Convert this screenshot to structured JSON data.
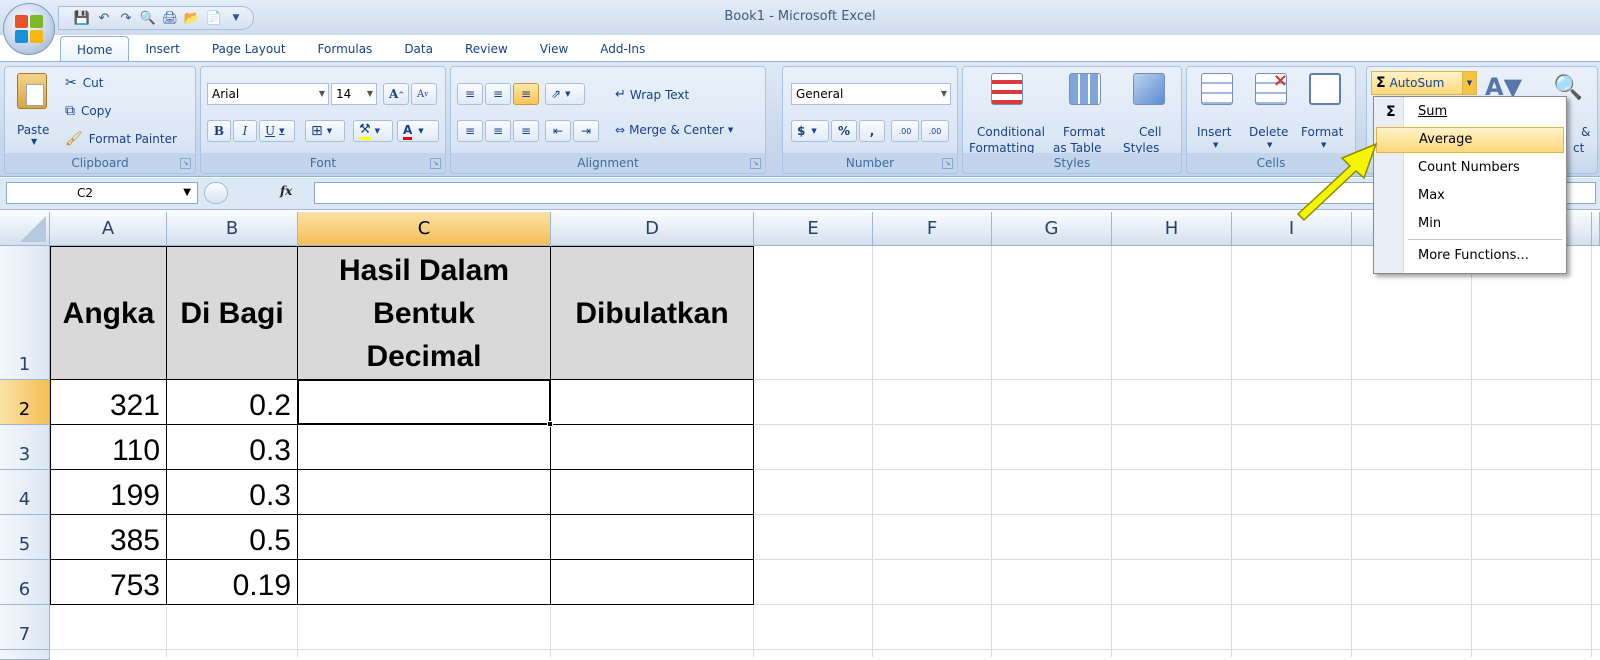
{
  "window": {
    "title": "Book1 - Microsoft Excel"
  },
  "tabs": [
    "Home",
    "Insert",
    "Page Layout",
    "Formulas",
    "Data",
    "Review",
    "View",
    "Add-Ins"
  ],
  "ribbon": {
    "clipboard": {
      "label": "Clipboard",
      "paste": "Paste",
      "cut": "Cut",
      "copy": "Copy",
      "format_painter": "Format Painter"
    },
    "font": {
      "label": "Font",
      "name": "Arial",
      "size": "14",
      "bold": "B",
      "italic": "I",
      "underline": "U",
      "grow": "A",
      "shrink": "A",
      "color_letter": "A"
    },
    "alignment": {
      "label": "Alignment",
      "wrap": "Wrap Text",
      "merge": "Merge & Center"
    },
    "number": {
      "label": "Number",
      "format": "General",
      "currency": "$",
      "percent": "%",
      "comma": ",",
      "inc_dec": ".00",
      "dec_dec": ".00"
    },
    "styles": {
      "label": "Styles",
      "conditional_1": "Conditional",
      "conditional_2": "Formatting",
      "format_table_1": "Format",
      "format_table_2": "as Table",
      "cell_styles_1": "Cell",
      "cell_styles_2": "Styles"
    },
    "cells": {
      "label": "Cells",
      "insert": "Insert",
      "delete": "Delete",
      "format": "Format"
    },
    "editing": {
      "autosum": "AutoSum",
      "sort_tail": "&",
      "sort_tail2": "ct"
    }
  },
  "formula_bar": {
    "name_box": "C2",
    "fx": "fx",
    "value": ""
  },
  "columns": [
    "A",
    "B",
    "C",
    "D",
    "E",
    "F",
    "G",
    "H",
    "I"
  ],
  "rows": [
    "1",
    "2",
    "3",
    "4",
    "5",
    "6",
    "7"
  ],
  "table": {
    "headers": [
      "Angka",
      "Di Bagi",
      "Hasil Dalam Bentuk Decimal",
      "Dibulatkan"
    ],
    "rows": [
      {
        "angka": "321",
        "dibagi": "0.2"
      },
      {
        "angka": "110",
        "dibagi": "0.3"
      },
      {
        "angka": "199",
        "dibagi": "0.3"
      },
      {
        "angka": "385",
        "dibagi": "0.5"
      },
      {
        "angka": "753",
        "dibagi": "0.19"
      }
    ]
  },
  "autosum_menu": {
    "sigma": "Σ",
    "items": [
      "Sum",
      "Average",
      "Count Numbers",
      "Max",
      "Min",
      "More Functions..."
    ],
    "highlighted": "Average"
  },
  "colors": {
    "accent": "#15428b",
    "highlight": "#fcd87a",
    "arrow": "#f5f500"
  }
}
